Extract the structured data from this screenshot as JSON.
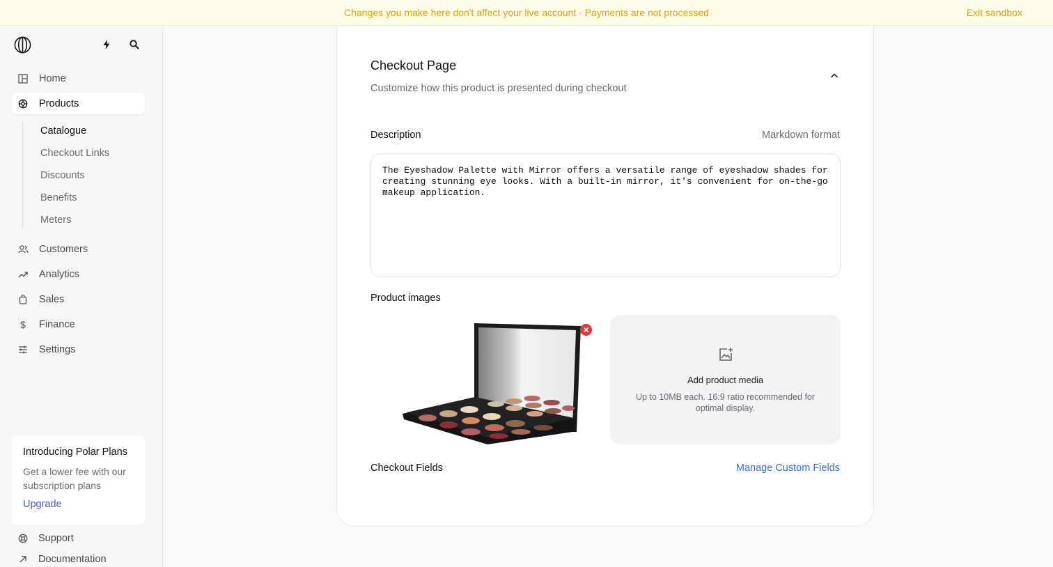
{
  "banner": {
    "message": "Changes you make here don't affect your live account · Payments are not processed",
    "exit_label": "Exit sandbox"
  },
  "sidebar": {
    "nav": [
      {
        "label": "Home",
        "icon": "home-icon"
      },
      {
        "label": "Products",
        "icon": "products-icon",
        "active": true
      },
      {
        "label": "Customers",
        "icon": "customers-icon"
      },
      {
        "label": "Analytics",
        "icon": "analytics-icon"
      },
      {
        "label": "Sales",
        "icon": "sales-icon"
      },
      {
        "label": "Finance",
        "icon": "finance-icon"
      },
      {
        "label": "Settings",
        "icon": "settings-icon"
      }
    ],
    "subnav": [
      "Catalogue",
      "Checkout Links",
      "Discounts",
      "Benefits",
      "Meters"
    ],
    "promo": {
      "title": "Introducing Polar Plans",
      "text": "Get a lower fee with our subscription plans",
      "link": "Upgrade"
    },
    "footer": [
      {
        "label": "Support",
        "icon": "support-icon"
      },
      {
        "label": "Documentation",
        "icon": "external-link-icon"
      }
    ]
  },
  "checkout": {
    "title": "Checkout Page",
    "subtitle": "Customize how this product is presented during checkout",
    "description_label": "Description",
    "format_hint": "Markdown format",
    "description_value": "The Eyeshadow Palette with Mirror offers a versatile range of eyeshadow shades for\ncreating stunning eye looks. With a built-in mirror, it's convenient for on-the-go\nmakeup application.",
    "images_label": "Product images",
    "dropzone_title": "Add product media",
    "dropzone_text": "Up to 10MB each. 16:9 ratio recommended for optimal display.",
    "fields_label": "Checkout Fields",
    "manage_link": "Manage Custom Fields"
  },
  "colors": {
    "banner_text": "#d4a617",
    "link": "#3b6fd8",
    "remove": "#e03a3a"
  }
}
